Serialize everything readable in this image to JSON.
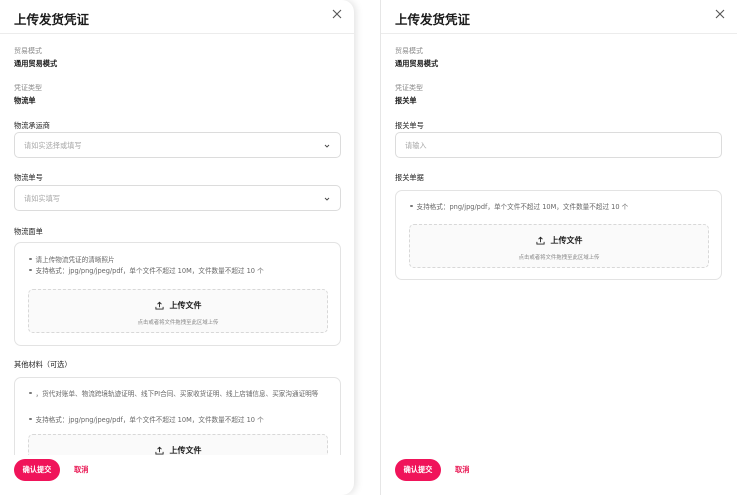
{
  "left": {
    "title": "上传发货凭证",
    "trade_mode_label": "贸易模式",
    "trade_mode_value": "通用贸易模式",
    "voucher_type_label": "凭证类型",
    "voucher_type_value": "物流单",
    "carrier_label": "物流承运商",
    "carrier_placeholder": "请如实选择或填写",
    "tracking_label": "物流单号",
    "tracking_placeholder": "请如实填写",
    "waybill_label": "物流面单",
    "waybill_bullets": [
      "请上传物流凭证的清晰照片",
      "支持格式：jpg/png/jpeg/pdf，单个文件不超过 10M，文件数量不超过 10 个"
    ],
    "upload_label": "上传文件",
    "upload_hint": "点击或者将文件拖拽至此区域上传",
    "other_label": "其他材料（可选）",
    "other_bullets": [
      "，货代对账单、物流跨境轨迹证明、线下PI合同、买家收货证明、线上店铺信息、买家沟通证明等",
      "支持格式：jpg/png/jpeg/pdf，单个文件不超过 10M，文件数量不超过 10 个"
    ],
    "other_upload_label": "上传文件",
    "confirm_label": "确认提交",
    "cancel_label": "取消"
  },
  "right": {
    "title": "上传发货凭证",
    "trade_mode_label": "贸易模式",
    "trade_mode_value": "通用贸易模式",
    "voucher_type_label": "凭证类型",
    "voucher_type_value": "报关单",
    "customs_no_label": "报关单号",
    "customs_no_placeholder": "请输入",
    "customs_doc_label": "报关单据",
    "customs_bullets": [
      "支持格式：png/jpg/pdf，单个文件不超过 10M，文件数量不超过 10 个"
    ],
    "upload_label": "上传文件",
    "upload_hint": "点击或者将文件拖拽至此区域上传",
    "confirm_label": "确认提交",
    "cancel_label": "取消"
  },
  "colors": {
    "accent": "#f0145a",
    "border": "#dcdcdc",
    "muted": "#8a8a8a"
  },
  "icons": {
    "close": "close-icon",
    "chevron": "chevron-down-icon",
    "upload": "upload-icon"
  }
}
